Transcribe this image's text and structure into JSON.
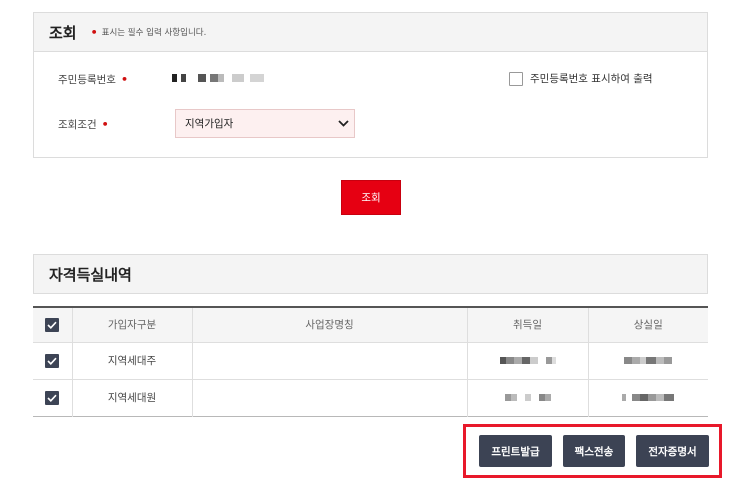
{
  "query": {
    "title": "조회",
    "required_note": "표시는 필수 입력 사항입니다.",
    "required_marker": "•",
    "ssn_label": "주민등록번호",
    "ssn_print_checkbox_label": "주민등록번호 표시하여 출력",
    "ssn_print_checked": false,
    "condition_label": "조회조건",
    "condition_selected": "지역가입자",
    "search_button_label": "조회"
  },
  "history": {
    "title": "자격득실내역",
    "columns": [
      "가입자구분",
      "사업장명칭",
      "취득일",
      "상실일"
    ],
    "header_checked": true,
    "rows": [
      {
        "checked": true,
        "type": "지역세대주",
        "workplace": ""
      },
      {
        "checked": true,
        "type": "지역세대원",
        "workplace": ""
      }
    ]
  },
  "actions": {
    "print_label": "프린트발급",
    "fax_label": "팩스전송",
    "ecert_label": "전자증명서"
  },
  "colors": {
    "accent_red": "#e60012",
    "dark_button": "#3c4354",
    "required_dot": "#d01010",
    "highlight_border": "#e8182a"
  }
}
